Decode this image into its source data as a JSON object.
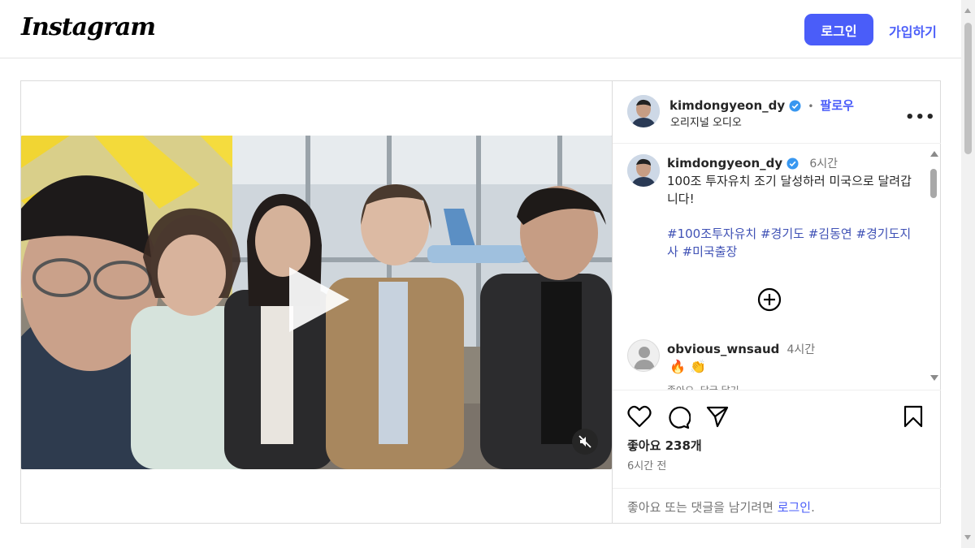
{
  "topbar": {
    "logo": "Instagram",
    "login_label": "로그인",
    "signup_label": "가입하기"
  },
  "post": {
    "author": "kimdongyeon_dy",
    "follow_label": "팔로우",
    "separator": "•",
    "audio_label": "오리지널 오디오",
    "more_label": "•••",
    "caption": {
      "time": "6시간",
      "text": "100조 투자유치 조기 달성하러 미국으로 달려갑니다!",
      "hashtags": "#100조투자유치 #경기도 #김동연 #경기도지사 #미국출장"
    },
    "comments": [
      {
        "user": "obvious_wnsaud",
        "time": "4시간",
        "text": "🔥 👏",
        "meta": "좋아요  답글 달기"
      }
    ],
    "likes": "좋아요 238개",
    "posted_ago": "6시간 전",
    "login_prompt": {
      "text": "좋아요 또는 댓글을 남기려면 ",
      "link": "로그인",
      "suffix": "."
    }
  },
  "icons": {
    "heart": "heart-icon",
    "comment": "comment-icon",
    "share": "share-icon",
    "save": "bookmark-icon",
    "mute": "muted-speaker-icon",
    "play": "play-icon",
    "expand": "plus-circle-icon"
  },
  "colors": {
    "accent": "#4a5df9",
    "verified": "#3897f0",
    "hashtag": "#3f51b5"
  }
}
